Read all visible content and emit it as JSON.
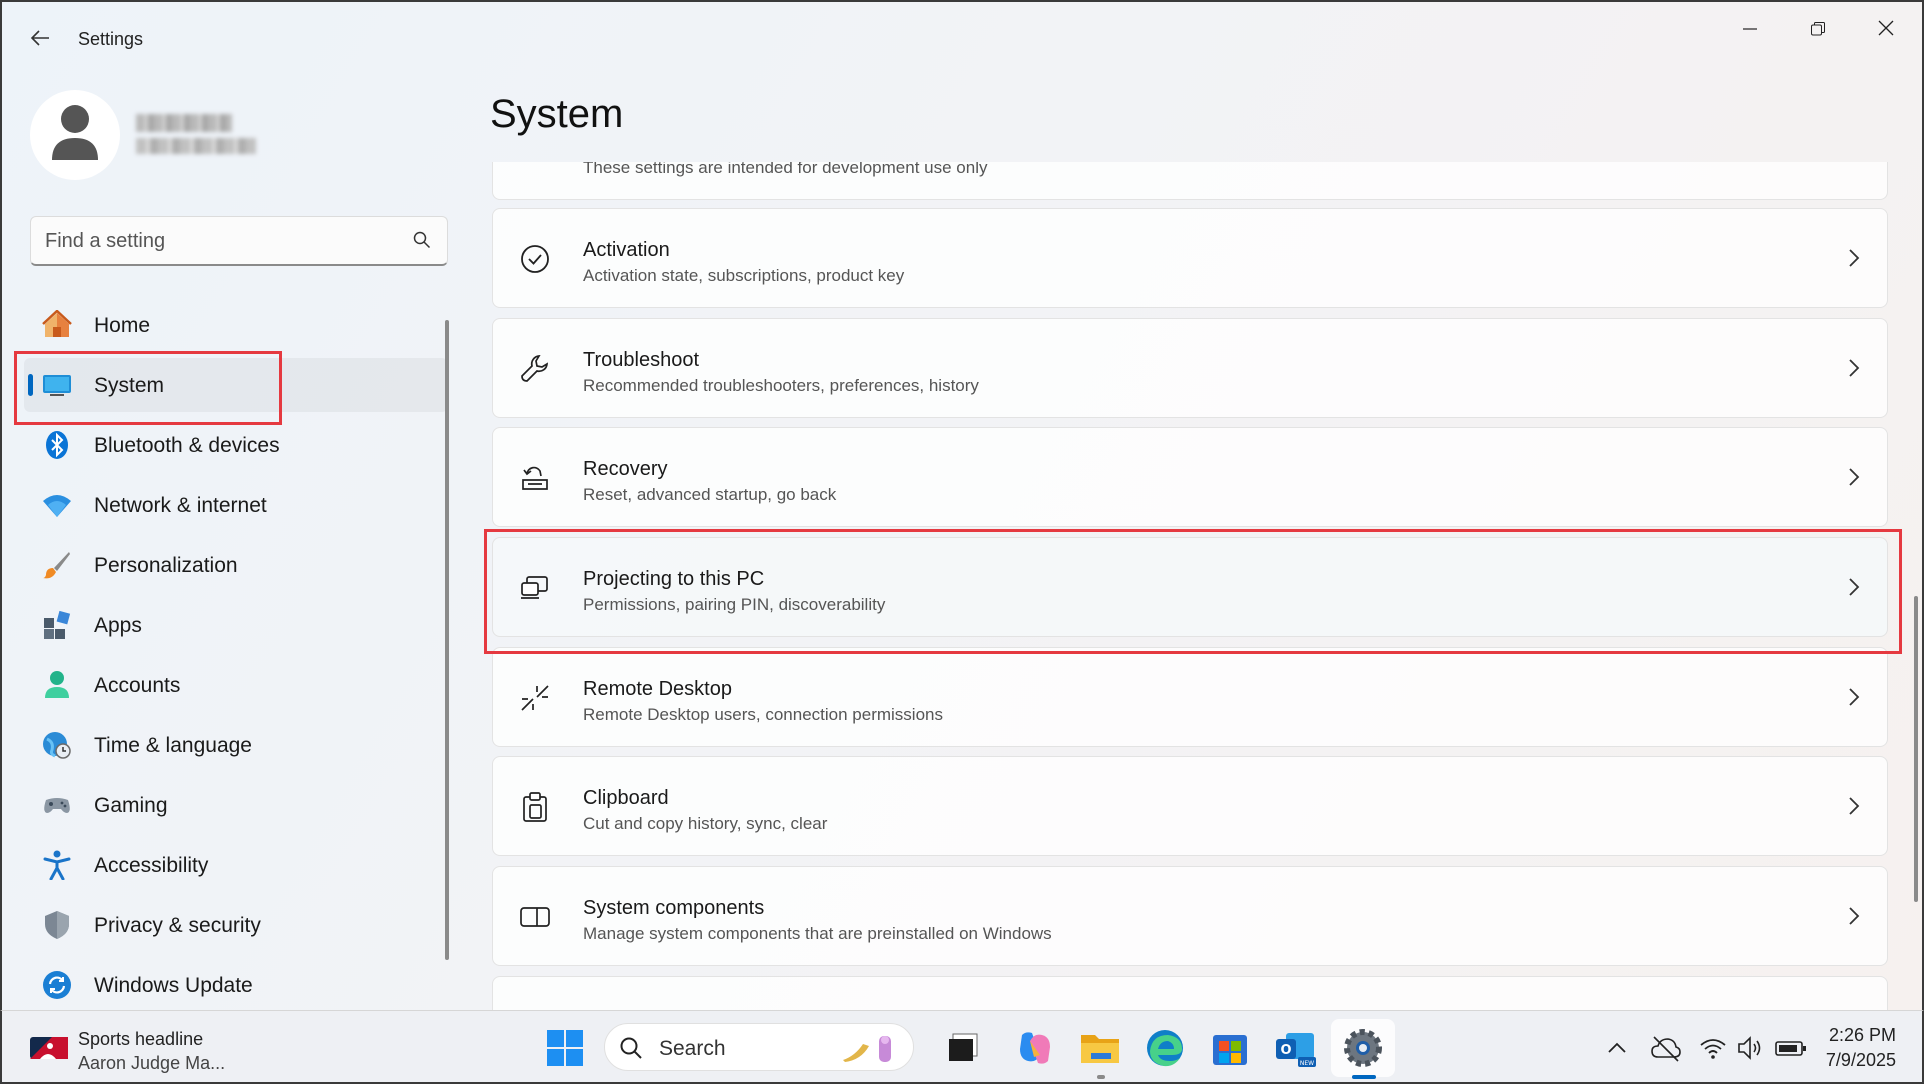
{
  "window": {
    "title": "Settings",
    "controls": {
      "minimize": "—",
      "maximize": "❐",
      "close": "✕"
    }
  },
  "profile": {
    "name": "(blurred)",
    "account": "(blurred)"
  },
  "search": {
    "placeholder": "Find a setting"
  },
  "sidebar": {
    "items": [
      {
        "label": "Home",
        "icon": "home-icon"
      },
      {
        "label": "System",
        "icon": "system-icon",
        "selected": true
      },
      {
        "label": "Bluetooth & devices",
        "icon": "bluetooth-icon"
      },
      {
        "label": "Network & internet",
        "icon": "wifi-icon"
      },
      {
        "label": "Personalization",
        "icon": "brush-icon"
      },
      {
        "label": "Apps",
        "icon": "apps-icon"
      },
      {
        "label": "Accounts",
        "icon": "person-icon"
      },
      {
        "label": "Time & language",
        "icon": "globe-clock-icon"
      },
      {
        "label": "Gaming",
        "icon": "gamepad-icon"
      },
      {
        "label": "Accessibility",
        "icon": "accessibility-icon"
      },
      {
        "label": "Privacy & security",
        "icon": "shield-icon"
      },
      {
        "label": "Windows Update",
        "icon": "update-icon"
      }
    ]
  },
  "main": {
    "title": "System",
    "cards": [
      {
        "title": "",
        "desc": "These settings are intended for development use only",
        "icon": "developer-icon"
      },
      {
        "title": "Activation",
        "desc": "Activation state, subscriptions, product key",
        "icon": "check-circle-icon"
      },
      {
        "title": "Troubleshoot",
        "desc": "Recommended troubleshooters, preferences, history",
        "icon": "wrench-icon"
      },
      {
        "title": "Recovery",
        "desc": "Reset, advanced startup, go back",
        "icon": "recovery-icon"
      },
      {
        "title": "Projecting to this PC",
        "desc": "Permissions, pairing PIN, discoverability",
        "icon": "projection-icon"
      },
      {
        "title": "Remote Desktop",
        "desc": "Remote Desktop users, connection permissions",
        "icon": "remote-desktop-icon"
      },
      {
        "title": "Clipboard",
        "desc": "Cut and copy history, sync, clear",
        "icon": "clipboard-icon"
      },
      {
        "title": "System components",
        "desc": "Manage system components that are preinstalled on Windows",
        "icon": "components-icon"
      },
      {
        "title": "",
        "desc": "",
        "icon": ""
      }
    ]
  },
  "taskbar": {
    "news": {
      "title": "Sports headline",
      "subtitle": "Aaron Judge Ma..."
    },
    "search_label": "Search",
    "apps": [
      "start-icon",
      "task-view-icon",
      "copilot-icon",
      "file-explorer-icon",
      "edge-icon",
      "store-icon",
      "outlook-icon",
      "settings-icon"
    ],
    "clock": {
      "time": "2:26 PM",
      "date": "7/9/2025"
    }
  },
  "colors": {
    "accent": "#0067c0",
    "highlight": "#e53940"
  }
}
